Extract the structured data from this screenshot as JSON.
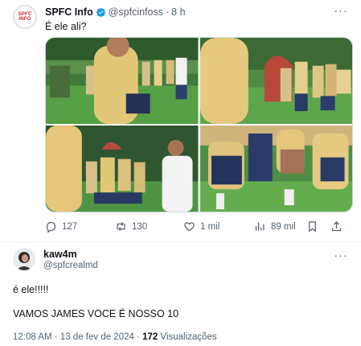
{
  "tweet": {
    "avatar_text_line1": "SPFC",
    "avatar_text_line2": "INFO",
    "author_name": "SPFC Info",
    "author_handle": "@spfcinfoss",
    "separator": "·",
    "time": "8 h",
    "text": "É ele ali?",
    "more_label": "···",
    "actions": {
      "replies": "127",
      "retweets": "130",
      "likes": "1 mil",
      "views": "89 mil"
    }
  },
  "reply": {
    "author_name": "kaw4m",
    "author_handle": "@spfcrealmd",
    "more_label": "···",
    "line1": "é ele!!!!!",
    "line2": "VAMOS JAMES VOCE É NOSSO 10",
    "timestamp": "12:08 AM · 13 de fev de 2024 · ",
    "views_count": "172",
    "views_label": " Visualizações"
  },
  "colors": {
    "text": "#0f1419",
    "muted": "#536471",
    "verified": "#1d9bf0",
    "brand_red": "#d01f25"
  }
}
